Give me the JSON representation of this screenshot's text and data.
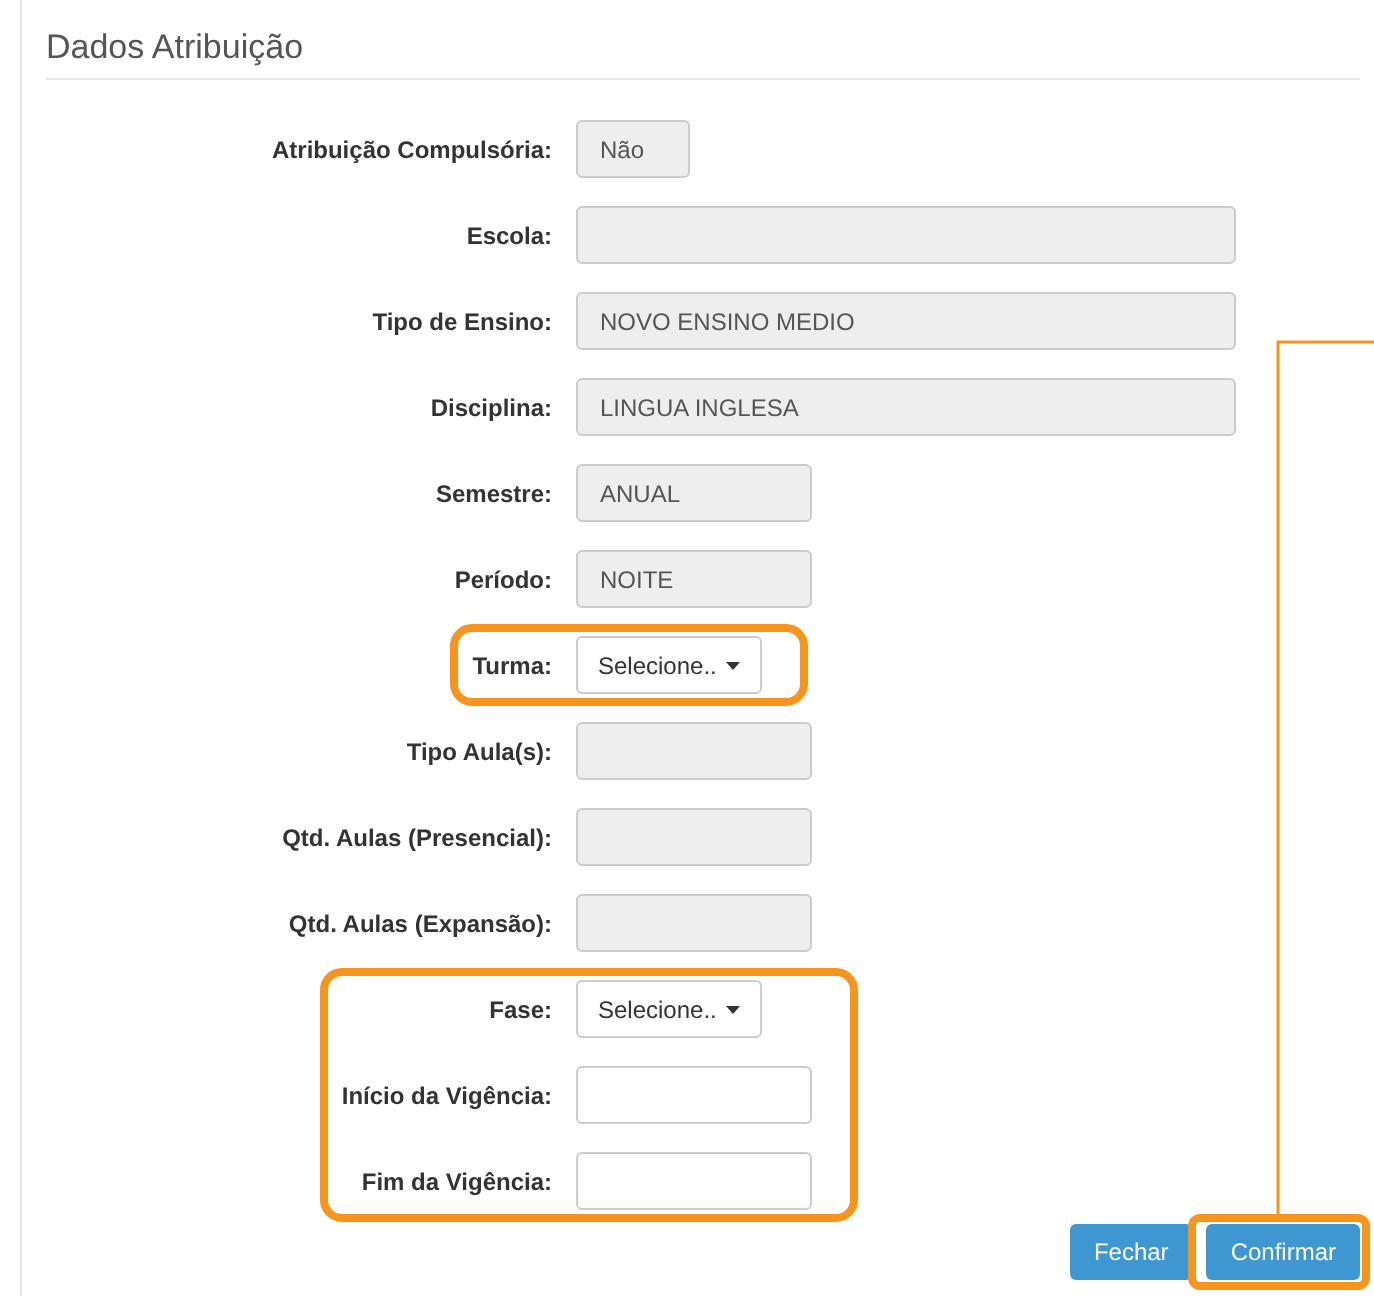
{
  "section": {
    "title": "Dados Atribuição"
  },
  "groups": [
    {
      "highlighted": false,
      "rows": [
        {
          "label": "Atribuição Compulsória:",
          "kind": "flag",
          "value": "Não"
        },
        {
          "label": "Escola:",
          "kind": "wide"
        },
        {
          "label": "Tipo de Ensino:",
          "kind": "wide",
          "value": "NOVO ENSINO MEDIO"
        },
        {
          "label": "Disciplina:",
          "kind": "wide",
          "value": "LINGUA INGLESA"
        },
        {
          "label": "Semestre:",
          "kind": "readonly",
          "value": "ANUAL"
        },
        {
          "label": "Período:",
          "kind": "readonly",
          "value": "NOITE"
        }
      ]
    },
    {
      "highlighted": true,
      "rows": [
        {
          "label": "Turma:",
          "kind": "select",
          "value": "Selecione.."
        }
      ]
    },
    {
      "highlighted": false,
      "rows": [
        {
          "label": "Tipo Aula(s):",
          "kind": "readonly"
        },
        {
          "label": "Qtd. Aulas (Presencial):",
          "kind": "readonly"
        },
        {
          "label": "Qtd. Aulas (Expansão):",
          "kind": "readonly"
        }
      ]
    },
    {
      "highlighted": true,
      "rows": [
        {
          "label": "Fase:",
          "kind": "select",
          "value": "Selecione.."
        },
        {
          "label": "Início da Vigência:",
          "kind": "input"
        },
        {
          "label": "Fim da Vigência:",
          "kind": "input"
        }
      ]
    }
  ],
  "buttons": [
    {
      "label": "Fechar",
      "highlighted": false
    },
    {
      "label": "Confirmar",
      "highlighted": true
    }
  ]
}
